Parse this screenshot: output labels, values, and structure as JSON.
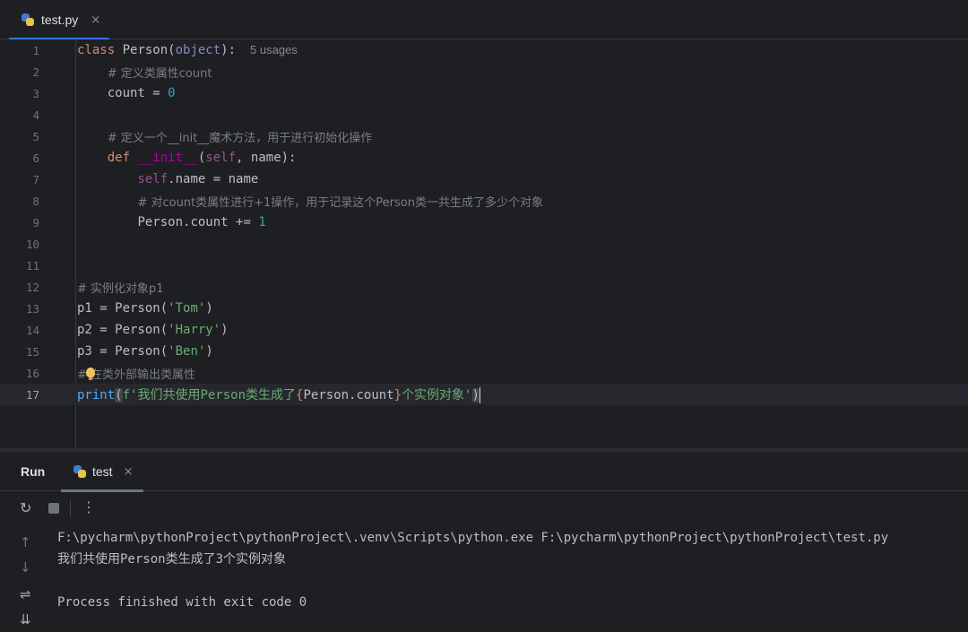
{
  "editor": {
    "tab": {
      "file_name": "test.py",
      "close": "×"
    },
    "usages": "5 usages",
    "lines": [
      {
        "n": "1"
      },
      {
        "n": "2"
      },
      {
        "n": "3"
      },
      {
        "n": "4"
      },
      {
        "n": "5"
      },
      {
        "n": "6"
      },
      {
        "n": "7"
      },
      {
        "n": "8"
      },
      {
        "n": "9"
      },
      {
        "n": "10"
      },
      {
        "n": "11"
      },
      {
        "n": "12"
      },
      {
        "n": "13"
      },
      {
        "n": "14"
      },
      {
        "n": "15"
      },
      {
        "n": "16"
      },
      {
        "n": "17"
      }
    ],
    "code": {
      "l1": {
        "kw": "class",
        "name": " Person(",
        "base": "object",
        "end": "):"
      },
      "l2": "# 定义类属性count",
      "l3": {
        "a": "count = ",
        "num": "0"
      },
      "l5": "# 定义一个__init__魔术方法，用于进行初始化操作",
      "l6": {
        "kw": "def",
        "sp": " ",
        "fn": "__init__",
        "open": "(",
        "self": "self",
        "rest": ", name):"
      },
      "l7": {
        "self": "self",
        "rest": ".name = name"
      },
      "l8": "# 对count类属性进行+1操作，用于记录这个Person类一共生成了多少个对象",
      "l9": {
        "a": "Person.count += ",
        "num": "1"
      },
      "l12": "# 实例化对象p1",
      "l13": {
        "a": "p1 = Person(",
        "str": "'Tom'",
        "b": ")"
      },
      "l14": {
        "a": "p2 = Person(",
        "str": "'Harry'",
        "b": ")"
      },
      "l15": {
        "a": "p3 = Person(",
        "str": "'Ben'",
        "b": ")"
      },
      "l16": "# 在类外部输出类属性",
      "l17": {
        "fn": "print",
        "open": "(",
        "s1": "f'我们共使用Person类生成了",
        "brace_open": "{",
        "expr": "Person.count",
        "brace_close": "}",
        "s2": "个实例对象'",
        "close": ")"
      }
    }
  },
  "run": {
    "title": "Run",
    "tab_label": "test",
    "close": "×",
    "output": [
      "F:\\pycharm\\pythonProject\\pythonProject\\.venv\\Scripts\\python.exe F:\\pycharm\\pythonProject\\pythonProject\\test.py",
      "我们共使用Person类生成了3个实例对象",
      "",
      "Process finished with exit code 0"
    ]
  },
  "icons": {
    "rerun": "↻",
    "more": "⋮",
    "up": "↑",
    "down": "↓",
    "wrap": "⇌",
    "scroll_end": "⇊"
  }
}
